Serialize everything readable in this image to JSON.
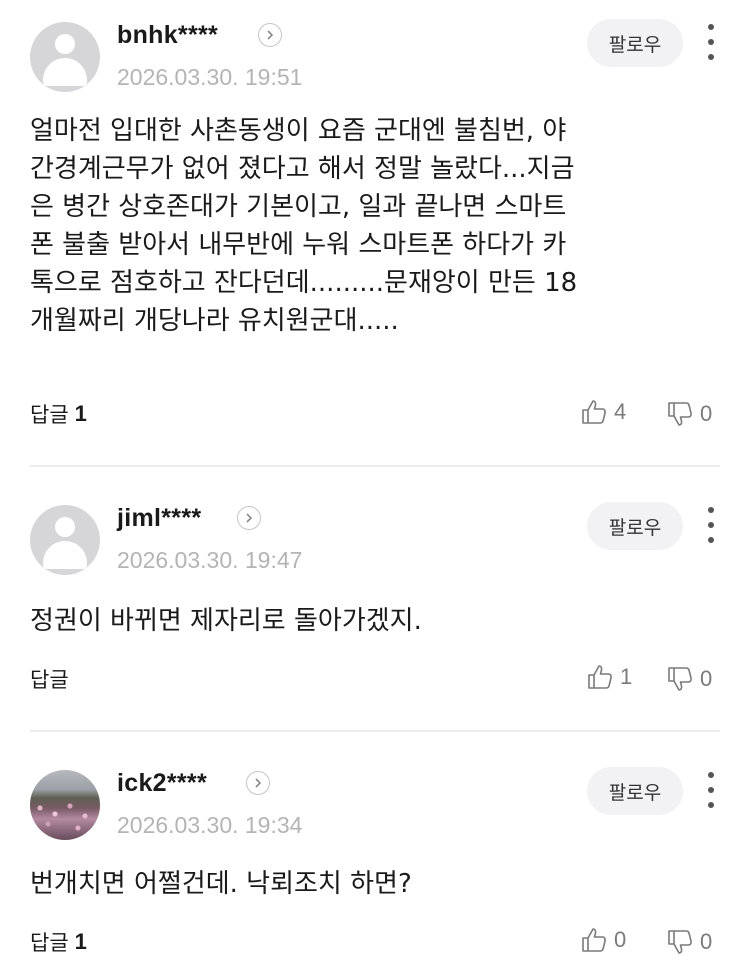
{
  "comments": [
    {
      "username": "bnhk****",
      "date": "2026.03.30. 19:51",
      "follow_label": "팔로우",
      "avatar": "default-avatar",
      "text": "얼마전 입대한 사촌동생이 요즘 군대엔 불침번, 야\n간경계근무가 없어 졌다고 해서 정말 놀랐다...지금\n은 병간 상호존대가 기본이고, 일과 끝나면 스마트\n폰 불출 받아서 내무반에 누워 스마트폰 하다가 카\n톡으로 점호하고 잔다던데.........문재앙이 만든 18\n개월짜리 개당나라 유치원군대.....",
      "reply_label": "답글",
      "reply_count": "1",
      "likes": "4",
      "dislikes": "0"
    },
    {
      "username": "jiml****",
      "date": "2026.03.30. 19:47",
      "follow_label": "팔로우",
      "avatar": "default-avatar",
      "text": "정권이 바뀌면 제자리로 돌아가겠지.",
      "reply_label": "답글",
      "reply_count": "",
      "likes": "1",
      "dislikes": "0"
    },
    {
      "username": "ick2****",
      "date": "2026.03.30. 19:34",
      "follow_label": "팔로우",
      "avatar": "photo-avatar",
      "text": "번개치면 어쩔건데. 낙뢰조치 하면?",
      "reply_label": "답글",
      "reply_count": "1",
      "likes": "0",
      "dislikes": "0"
    }
  ],
  "colors": {
    "date_gray": "#b4b4b4",
    "follow_bg": "#f2f2f4",
    "divider": "#ececec"
  }
}
